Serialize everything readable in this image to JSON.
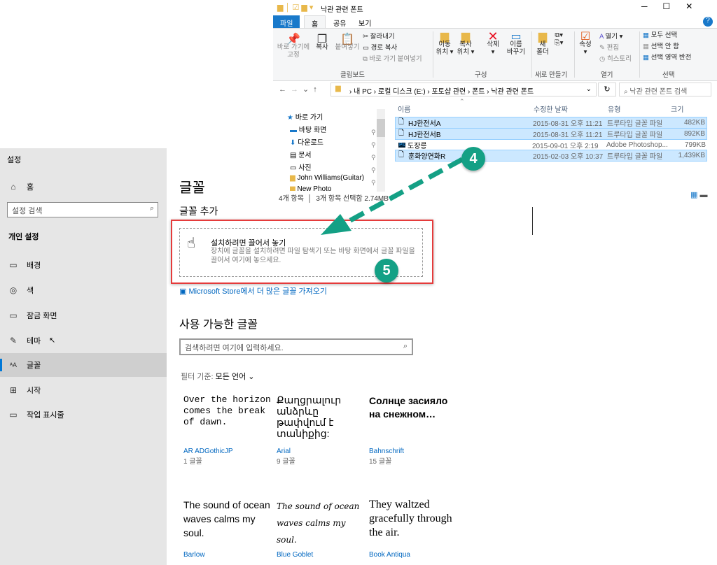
{
  "settings": {
    "title": "설정",
    "home": "홈",
    "search_placeholder": "설정 검색",
    "section": "개인 설정",
    "nav": [
      {
        "label": "배경",
        "icon": "image-icon"
      },
      {
        "label": "색",
        "icon": "palette-icon"
      },
      {
        "label": "잠금 화면",
        "icon": "lock-screen-icon"
      },
      {
        "label": "테마",
        "icon": "theme-icon"
      },
      {
        "label": "글꼴",
        "icon": "font-icon",
        "active": true
      },
      {
        "label": "시작",
        "icon": "start-icon"
      },
      {
        "label": "작업 표시줄",
        "icon": "taskbar-icon"
      }
    ],
    "page_title": "글꼴",
    "add_title": "글꼴 추가",
    "drop_title": "설치하려면 끌어서 놓기",
    "drop_desc": "장치에 글꼴을 설치하려면 파일 탐색기 또는 바탕 화면에서 글꼴 파일을 끌어서 여기에 놓으세요.",
    "store_link": "Microsoft Store에서 더 많은 글꼴 가져오기",
    "available_title": "사용 가능한 글꼴",
    "font_search_placeholder": "검색하려면 여기에 입력하세요.",
    "filter_label": "필터 기준:",
    "filter_value": "모든 언어",
    "fonts": [
      {
        "preview": "Over the horizon comes the break of dawn.",
        "name": "AR ADGothicJP",
        "count": "1 글꼴"
      },
      {
        "preview": "Քաղցրալուր անձրևը թափվում է տանիքից:",
        "name": "Arial",
        "count": "9 글꼴"
      },
      {
        "preview": "Солнце засияло на снежном…",
        "name": "Bahnschrift",
        "count": "15 글꼴"
      },
      {
        "preview": "The sound of ocean waves calms my soul.",
        "name": "Barlow",
        "count": ""
      },
      {
        "preview": "The sound of ocean waves calms my soul.",
        "name": "Blue Goblet",
        "count": ""
      },
      {
        "preview": "They waltzed gracefully through the air.",
        "name": "Book Antiqua",
        "count": ""
      }
    ]
  },
  "explorer": {
    "title": "낙관 관련 폰트",
    "tabs": [
      "파일",
      "홈",
      "공유",
      "보기"
    ],
    "ribbon": {
      "pin": "바로 가기에\n고정",
      "copy": "복사",
      "paste": "붙여넣기",
      "cut": "잘라내기",
      "copy_path": "경로 복사",
      "paste_shortcut": "바로 가기 붙여넣기",
      "clipboard": "클립보드",
      "move_to": "이동\n위치 ▾",
      "copy_to": "복사\n위치 ▾",
      "delete": "삭제\n▾",
      "rename": "이름\n바꾸기",
      "organize": "구성",
      "new_folder": "새\n폴더",
      "new": "새로 만들기",
      "properties": "속성\n▾",
      "open": "열기 ▾",
      "edit": "편집",
      "history": "히스토리",
      "open_group": "열기",
      "select_all": "모두 선택",
      "select_none": "선택 안 함",
      "invert": "선택 영역 반전",
      "select_group": "선택"
    },
    "breadcrumb": [
      "내 PC",
      "로컬 디스크 (E:)",
      "포토샵 관련",
      "폰트",
      "낙관 관련 폰트"
    ],
    "search_placeholder": "낙관 관련 폰트 검색",
    "nav": [
      "바로 가기",
      "바탕 화면",
      "다운로드",
      "문서",
      "사진",
      "John Williams(Guitar)",
      "New Photo"
    ],
    "columns": [
      "이름",
      "수정한 날짜",
      "유형",
      "크기"
    ],
    "files": [
      {
        "name": "HJ한전서A",
        "date": "2015-08-31 오후 11:21",
        "type": "트루타입 글꼴 파일",
        "size": "482KB",
        "selected": true
      },
      {
        "name": "HJ한전서B",
        "date": "2015-08-31 오후 11:21",
        "type": "트루타입 글꼴 파일",
        "size": "892KB",
        "selected": true
      },
      {
        "name": "도장릉",
        "date": "2015-09-01 오후 2:19",
        "type": "Adobe Photoshop...",
        "size": "799KB",
        "selected": false
      },
      {
        "name": "훈화양연화R",
        "date": "2015-02-03 오후 10:37",
        "type": "트루타입 글꼴 파일",
        "size": "1,439KB",
        "selected": true
      }
    ],
    "status_count": "4개 항목",
    "status_selected": "3개 항목 선택함 2.74MB"
  },
  "annotations": {
    "step4": "4",
    "step5": "5",
    "accent": "#14a085",
    "highlight": "#e53b3b"
  }
}
